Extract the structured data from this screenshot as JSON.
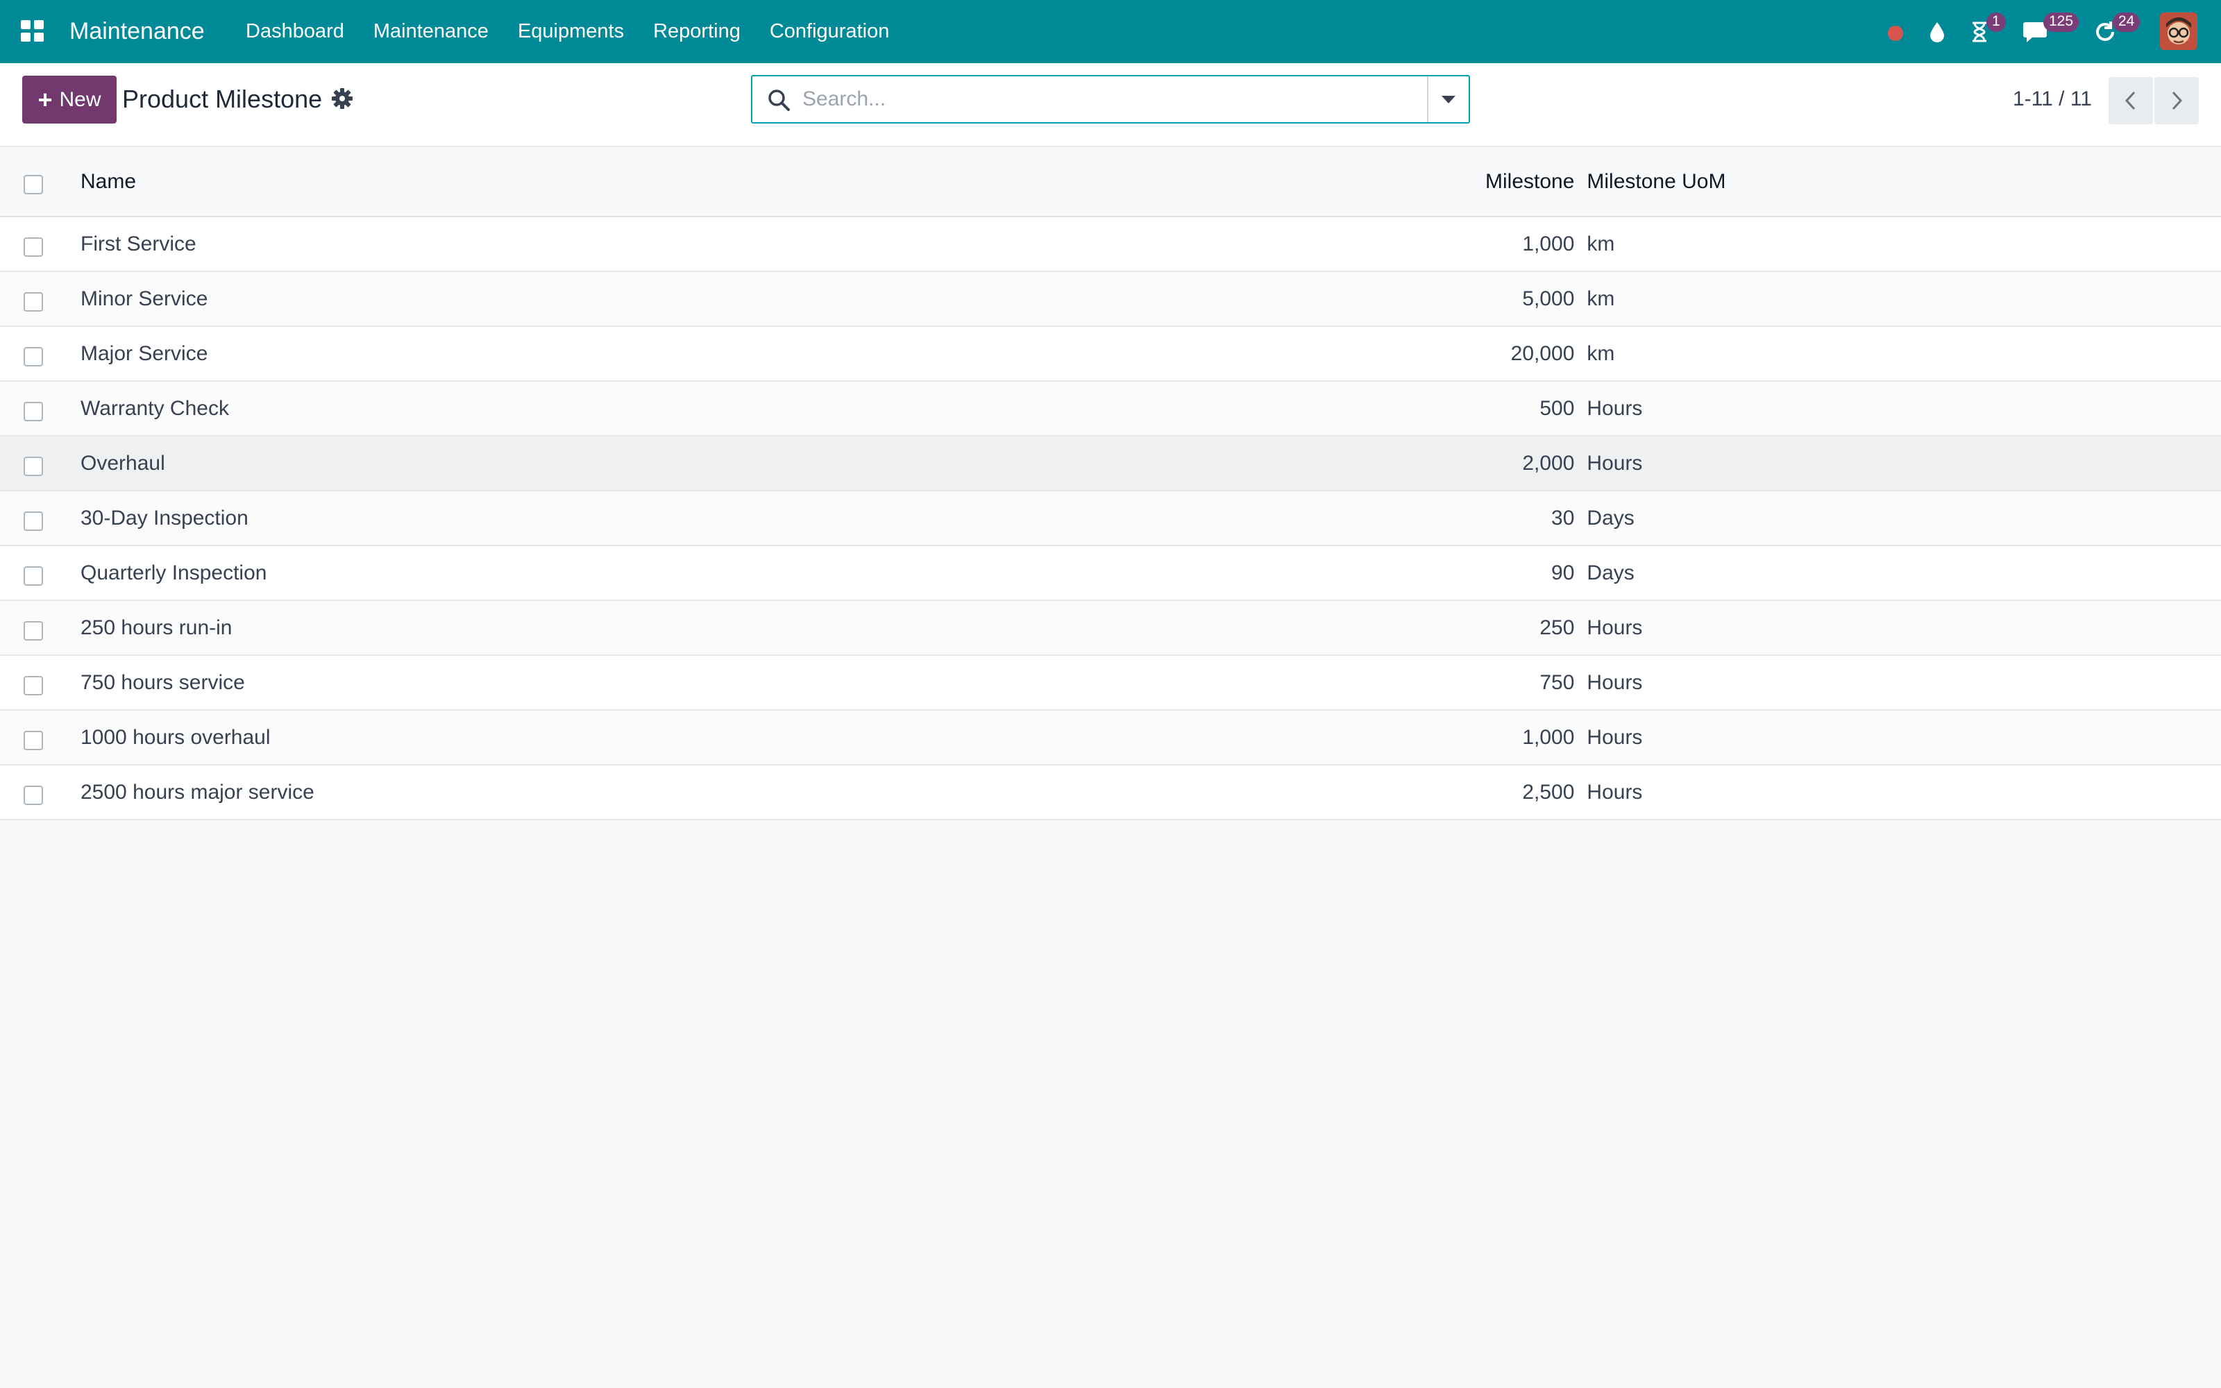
{
  "navbar": {
    "brand": "Maintenance",
    "menu": [
      "Dashboard",
      "Maintenance",
      "Equipments",
      "Reporting",
      "Configuration"
    ],
    "badges": {
      "activities": "1",
      "messages": "125",
      "updates": "24"
    }
  },
  "control_panel": {
    "new_label": "New",
    "title": "Product Milestone",
    "search_placeholder": "Search...",
    "pager": "1-11 / 11"
  },
  "table": {
    "columns": {
      "name": "Name",
      "milestone": "Milestone",
      "uom": "Milestone UoM"
    },
    "rows": [
      {
        "name": "First Service",
        "milestone": "1,000",
        "uom": "km"
      },
      {
        "name": "Minor Service",
        "milestone": "5,000",
        "uom": "km"
      },
      {
        "name": "Major Service",
        "milestone": "20,000",
        "uom": "km"
      },
      {
        "name": "Warranty Check",
        "milestone": "500",
        "uom": "Hours"
      },
      {
        "name": "Overhaul",
        "milestone": "2,000",
        "uom": "Hours"
      },
      {
        "name": "30-Day Inspection",
        "milestone": "30",
        "uom": "Days"
      },
      {
        "name": "Quarterly Inspection",
        "milestone": "90",
        "uom": "Days"
      },
      {
        "name": "250 hours run-in",
        "milestone": "250",
        "uom": "Hours"
      },
      {
        "name": "750 hours service",
        "milestone": "750",
        "uom": "Hours"
      },
      {
        "name": "1000 hours overhaul",
        "milestone": "1,000",
        "uom": "Hours"
      },
      {
        "name": "2500 hours major service",
        "milestone": "2,500",
        "uom": "Hours"
      }
    ]
  },
  "colors": {
    "navbar": "#008a98",
    "primary_button": "#71396e",
    "badge": "#7b3d77",
    "search_focus": "#00a0b5"
  }
}
